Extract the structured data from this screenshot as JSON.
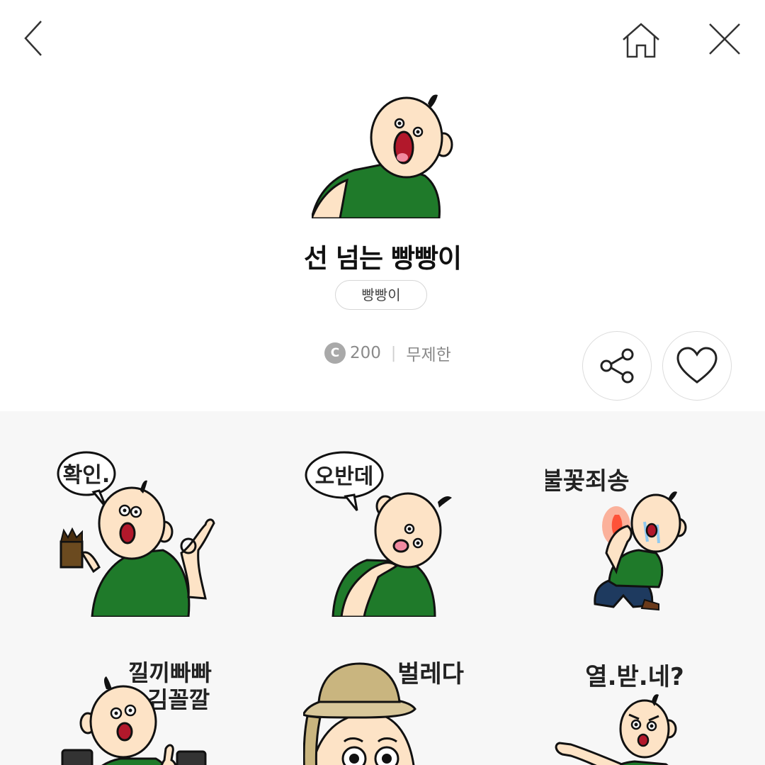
{
  "pack": {
    "title": "선 넘는 빵빵이",
    "author": "빵빵이",
    "price": "200",
    "coin_symbol": "C",
    "duration": "무제한"
  },
  "stickers": [
    {
      "caption": "확인."
    },
    {
      "caption": "오반데"
    },
    {
      "caption": "불꽃죄송"
    },
    {
      "caption_line1": "낄끼빠빠",
      "caption_line2": "김꼴깔"
    },
    {
      "caption": "벌레다"
    },
    {
      "caption": "열.받.네?"
    }
  ],
  "icons": [
    "back-arrow-icon",
    "home-icon",
    "close-icon",
    "share-icon",
    "heart-icon"
  ],
  "colors": {
    "shirt_green": "#1f7a2a",
    "skin": "#fde3c6",
    "grid_background": "#f7f7f7",
    "coin_gray": "#a9a9a9"
  }
}
